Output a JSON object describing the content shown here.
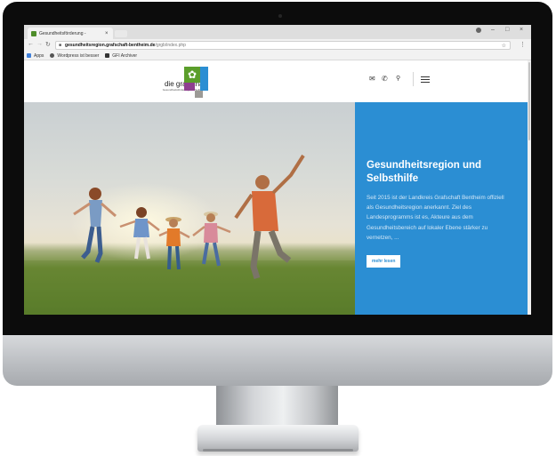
{
  "browser": {
    "tab_title": "Gesundheitsförderung - ",
    "tab_close": "×",
    "url_host": "gesundheitsregion.grafschaft-bentheim.de",
    "url_path": "/grgb/index.php",
    "bookmarks": [
      {
        "label": "Apps",
        "icon": "apps-grid-icon",
        "color": "#3f7fd9"
      },
      {
        "label": "Wordpress ist besser",
        "icon": "wordpress-icon",
        "color": "#555555"
      },
      {
        "label": "GFI Archiver",
        "icon": "archive-icon",
        "color": "#333333"
      }
    ]
  },
  "header": {
    "logo_text": "die grafschaft",
    "logo_subtext": "Gesundheitsförderung und Selbsthilfe",
    "icons": [
      "mail-icon",
      "phone-icon",
      "search-icon",
      "menu-icon"
    ]
  },
  "hero": {
    "title": "Gesundheitsregion und Selbsthilfe",
    "text": "Seit 2015 ist der Landkreis Grafschaft Bentheim offiziell als Gesundheitsregion anerkannt. Ziel des Landesprogramms ist es, Akteure aus dem Gesundheitsbereich auf lokaler Ebene stärker zu vernetzen, ...",
    "button_label": "mehr lesen"
  },
  "colors": {
    "brand_blue": "#2b8ed3",
    "brand_green": "#5b9e2b",
    "brand_purple": "#8e3f8f"
  }
}
